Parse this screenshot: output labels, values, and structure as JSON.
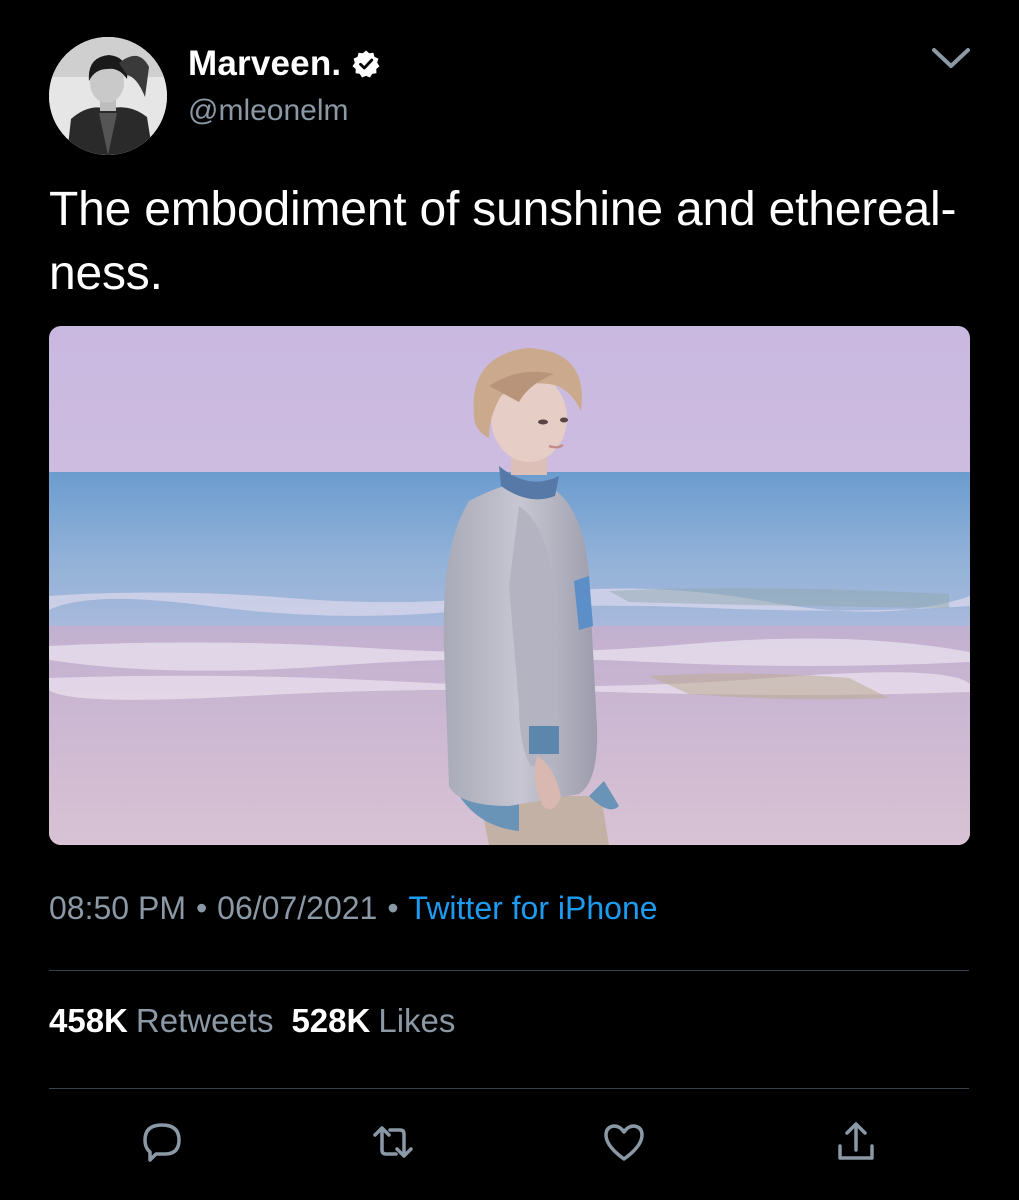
{
  "user": {
    "display_name": "Marveen.",
    "handle": "@mleonelm",
    "verified": true,
    "avatar_icon": "avatar"
  },
  "tweet": {
    "text": "The embodiment of sunshine and ethereal­ness.",
    "time": "08:50 PM",
    "date": "06/07/2021",
    "separator": "•",
    "source": "Twitter for iPhone"
  },
  "stats": {
    "retweets_count": "458K",
    "retweets_label": "Retweets",
    "likes_count": "528K",
    "likes_label": "Likes"
  },
  "actions": {
    "reply_icon": "reply-icon",
    "retweet_icon": "retweet-icon",
    "like_icon": "heart-icon",
    "share_icon": "share-icon"
  },
  "colors": {
    "background": "#000000",
    "text": "#ffffff",
    "secondary_text": "#8b98a5",
    "link": "#1d9bf0",
    "divider": "#38444d"
  }
}
